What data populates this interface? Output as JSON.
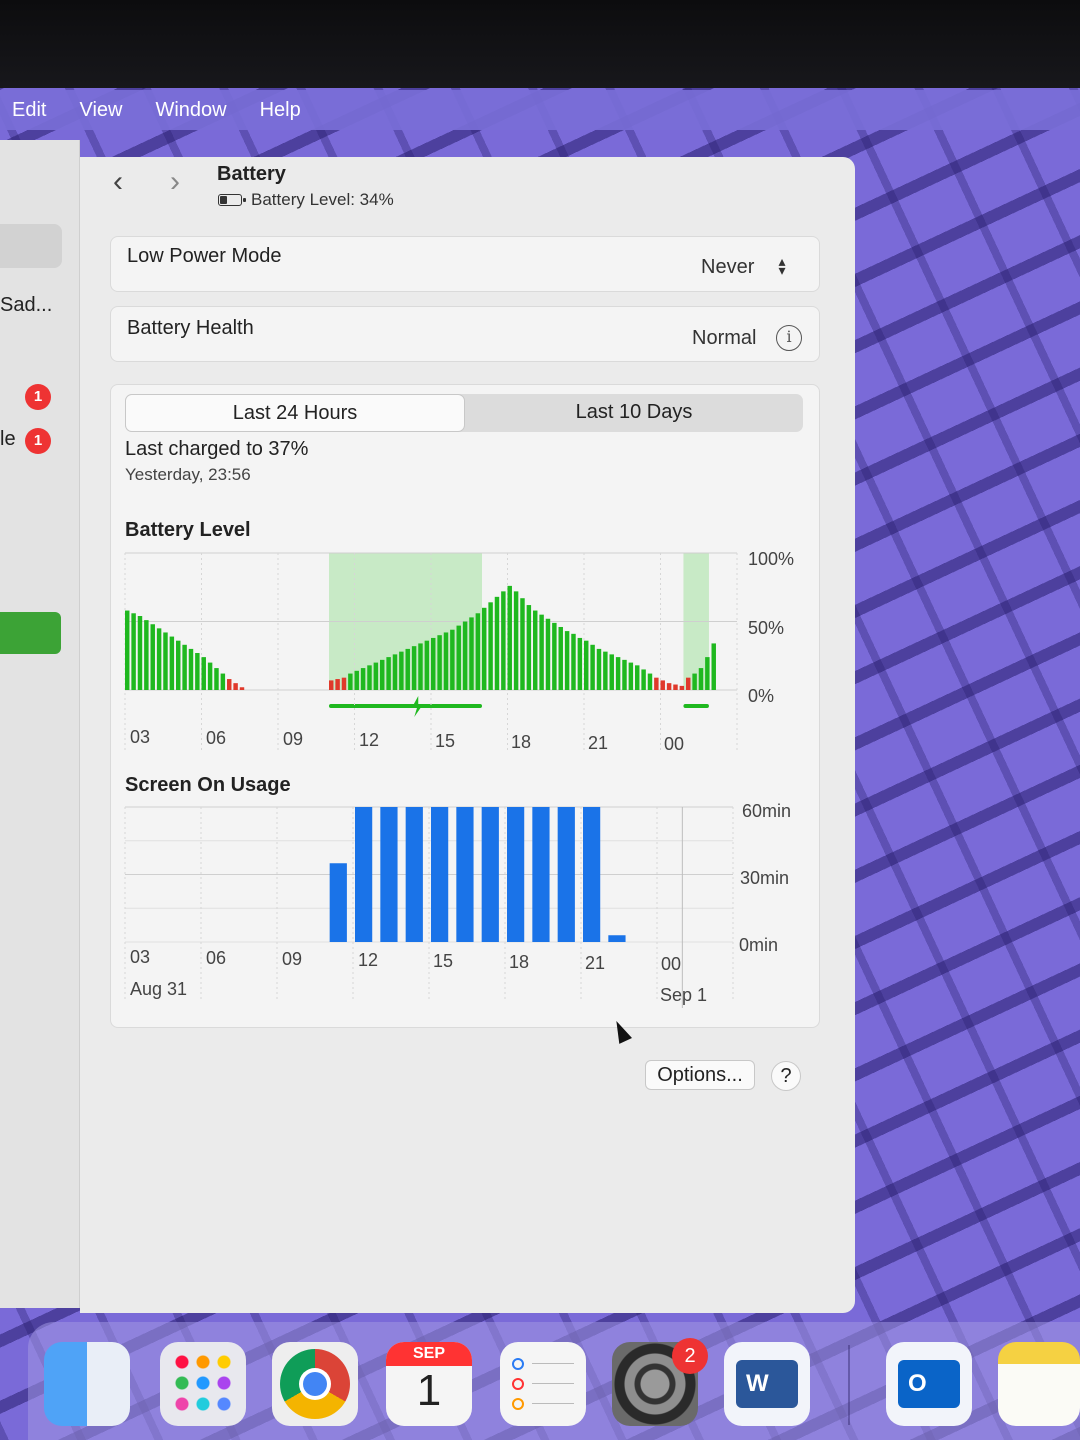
{
  "menubar": {
    "items": [
      "Edit",
      "View",
      "Window",
      "Help"
    ]
  },
  "sidebar": {
    "truncated_item_1": "Sad...",
    "truncated_item_2": "le",
    "badge_1": "1",
    "badge_2": "1"
  },
  "header": {
    "back_icon": "chevron-left-icon",
    "forward_icon": "chevron-right-icon",
    "title": "Battery",
    "battery_icon": "battery-icon",
    "subtitle": "Battery Level: 34%",
    "battery_fill_fraction": 0.34
  },
  "low_power_mode": {
    "label": "Low Power Mode",
    "value": "Never"
  },
  "battery_health": {
    "label": "Battery Health",
    "value": "Normal",
    "icon": "info-icon"
  },
  "tabs": {
    "items": [
      "Last 24 Hours",
      "Last 10 Days"
    ],
    "selected": "Last 24 Hours"
  },
  "last_charged": {
    "text": "Last charged to 37%",
    "time": "Yesterday, 23:56"
  },
  "colors": {
    "battery_bar": "#1fb81f",
    "battery_low_bar": "#e0392b",
    "charging_band": "#bfe8bd",
    "usage_bar": "#1a73e8",
    "sidebar_accent": "#3ca336"
  },
  "battery_chart_title": "Battery Level",
  "usage_chart_title": "Screen On Usage",
  "chart_data": [
    {
      "type": "bar",
      "title": "Battery Level",
      "x_tick_labels": [
        "03",
        "06",
        "09",
        "12",
        "15",
        "18",
        "21",
        "00"
      ],
      "y_tick_labels": [
        "100%",
        "50%",
        "0%"
      ],
      "ylim": [
        0,
        100
      ],
      "grid": true,
      "series": [
        {
          "x_hours": [
            0.0,
            0.25,
            0.5,
            0.75,
            1.0,
            1.25,
            1.5,
            1.75,
            2.0,
            2.25,
            2.5,
            2.75,
            3.0,
            3.25,
            3.5,
            3.75,
            4.0,
            4.25,
            4.5
          ],
          "values": [
            58,
            56,
            54,
            51,
            48,
            45,
            42,
            39,
            36,
            33,
            30,
            27,
            24,
            20,
            16,
            12,
            8,
            5,
            2
          ]
        },
        {
          "x_hours": [
            8.0,
            8.25,
            8.5,
            8.75,
            9.0,
            9.25,
            9.5,
            9.75,
            10.0,
            10.25,
            10.5,
            10.75,
            11.0,
            11.25,
            11.5,
            11.75,
            12.0,
            12.25,
            12.5,
            12.75,
            13.0,
            13.25,
            13.5,
            13.75,
            14.0,
            14.25,
            14.5,
            14.75,
            15.0,
            15.25,
            15.5,
            15.75,
            16.0,
            16.25,
            16.5,
            16.75,
            17.0,
            17.25,
            17.5,
            17.75,
            18.0,
            18.25,
            18.5,
            18.75,
            19.0,
            19.25,
            19.5,
            19.75,
            20.0,
            20.25,
            20.5,
            20.75,
            21.0,
            21.25,
            21.5,
            21.75
          ],
          "values": [
            7,
            8,
            9,
            12,
            14,
            16,
            18,
            20,
            22,
            24,
            26,
            28,
            30,
            32,
            34,
            36,
            38,
            40,
            42,
            44,
            47,
            50,
            53,
            56,
            60,
            64,
            68,
            72,
            76,
            72,
            67,
            62,
            58,
            55,
            52,
            49,
            46,
            43,
            41,
            38,
            36,
            33,
            30,
            28,
            26,
            24,
            22,
            20,
            18,
            15,
            12,
            9,
            7,
            5,
            4,
            3
          ]
        },
        {
          "x_hours": [
            22.0,
            22.25,
            22.5,
            22.75,
            23.0
          ],
          "values": [
            9,
            12,
            16,
            24,
            34
          ]
        }
      ],
      "low_threshold": 10,
      "charging_periods_hours": [
        [
          8.0,
          14.0
        ],
        [
          21.9,
          22.9
        ]
      ]
    },
    {
      "type": "bar",
      "title": "Screen On Usage",
      "x_tick_labels": [
        "03",
        "06",
        "09",
        "12",
        "15",
        "18",
        "21",
        "00"
      ],
      "date_labels": [
        "Aug 31",
        "Sep 1"
      ],
      "y_tick_labels": [
        "60min",
        "30min",
        "0min"
      ],
      "ylim": [
        0,
        60
      ],
      "grid": true,
      "hours": [
        8,
        9,
        10,
        11,
        12,
        13,
        14,
        15,
        16,
        17,
        18,
        19
      ],
      "values": [
        35,
        60,
        60,
        60,
        60,
        60,
        60,
        60,
        60,
        60,
        60,
        3
      ]
    }
  ],
  "footer": {
    "options_label": "Options...",
    "help_label": "?"
  },
  "dock": {
    "items": [
      "finder-icon",
      "launchpad-icon",
      "chrome-icon",
      "calendar-icon",
      "reminders-icon",
      "system-settings-icon",
      "word-icon",
      "outlook-icon",
      "notes-icon"
    ],
    "calendar_month": "SEP",
    "calendar_day": "1",
    "settings_badge": "2",
    "word_letter": "W",
    "outlook_letter": "O"
  }
}
